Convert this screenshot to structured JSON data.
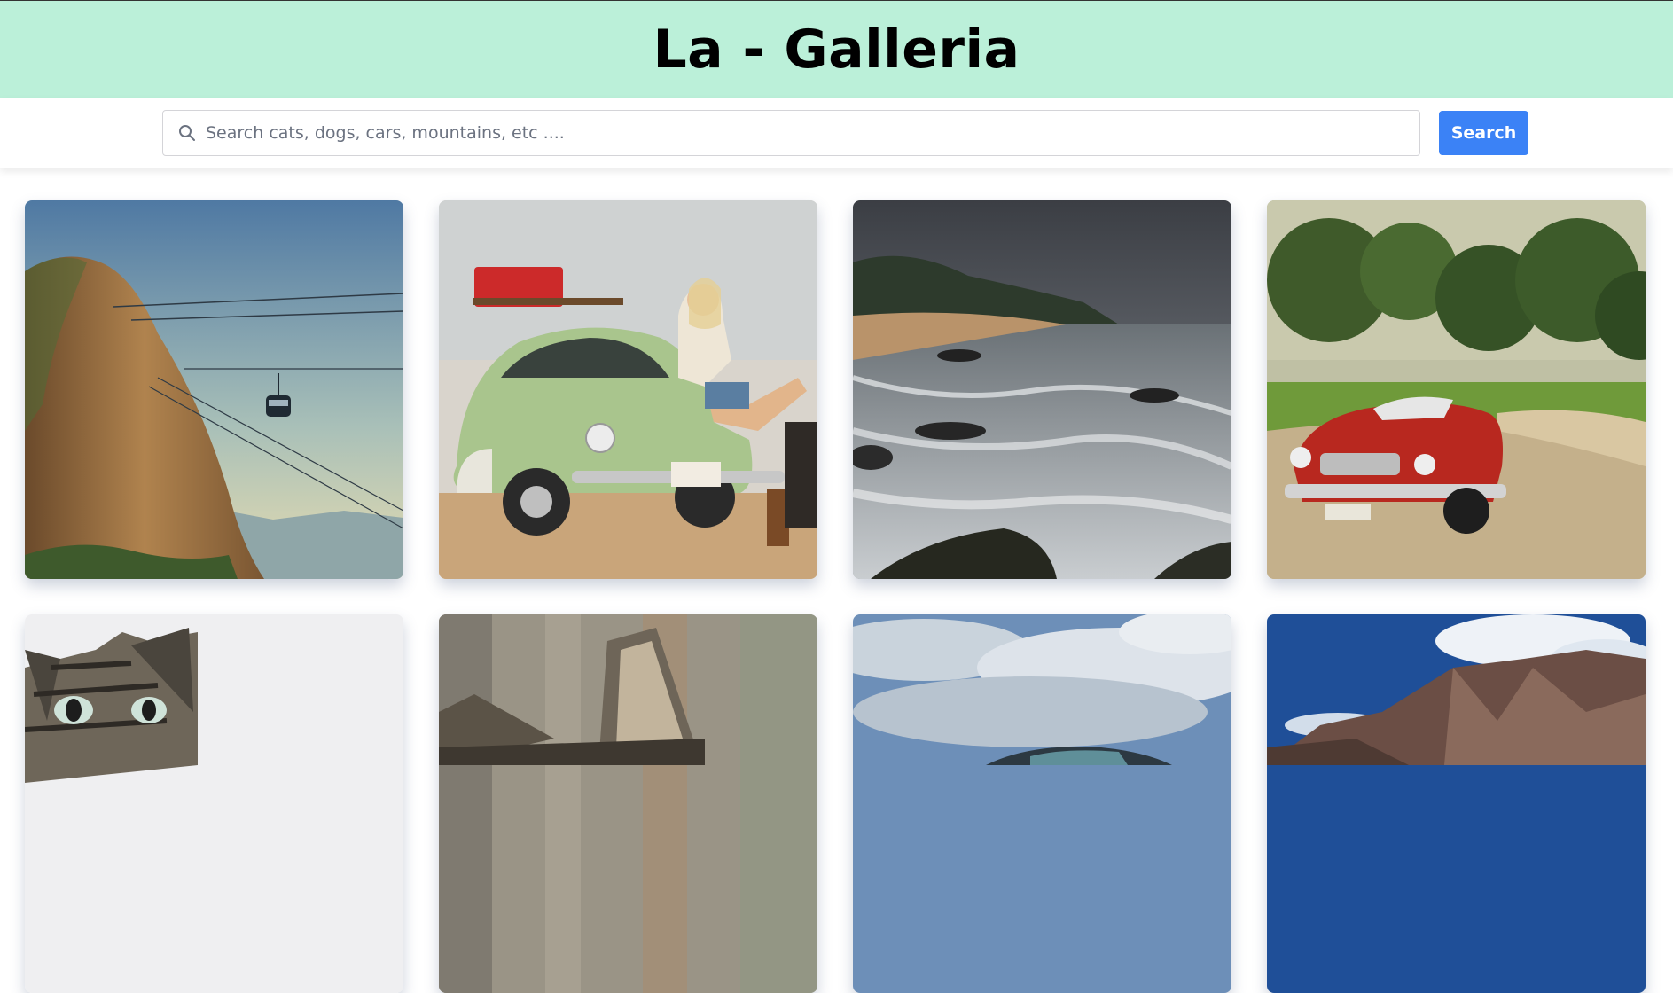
{
  "header": {
    "title": "La - Galleria"
  },
  "search": {
    "placeholder": "Search cats, dogs, cars, mountains, etc ....",
    "value": "",
    "button_label": "Search",
    "icon": "search-icon"
  },
  "colors": {
    "header_bg": "#bbf0d9",
    "accent": "#3b82f6"
  },
  "gallery": {
    "images": [
      {
        "subject": "sugarloaf-mountain-cable-car"
      },
      {
        "subject": "woman-with-green-vw-beetle"
      },
      {
        "subject": "stormy-rocky-beach"
      },
      {
        "subject": "red-vintage-convertible-car"
      },
      {
        "subject": "tabby-cat"
      },
      {
        "subject": "cat-ear-closeup"
      },
      {
        "subject": "car-under-cloudy-sky"
      },
      {
        "subject": "rocky-mountain-range"
      }
    ]
  }
}
